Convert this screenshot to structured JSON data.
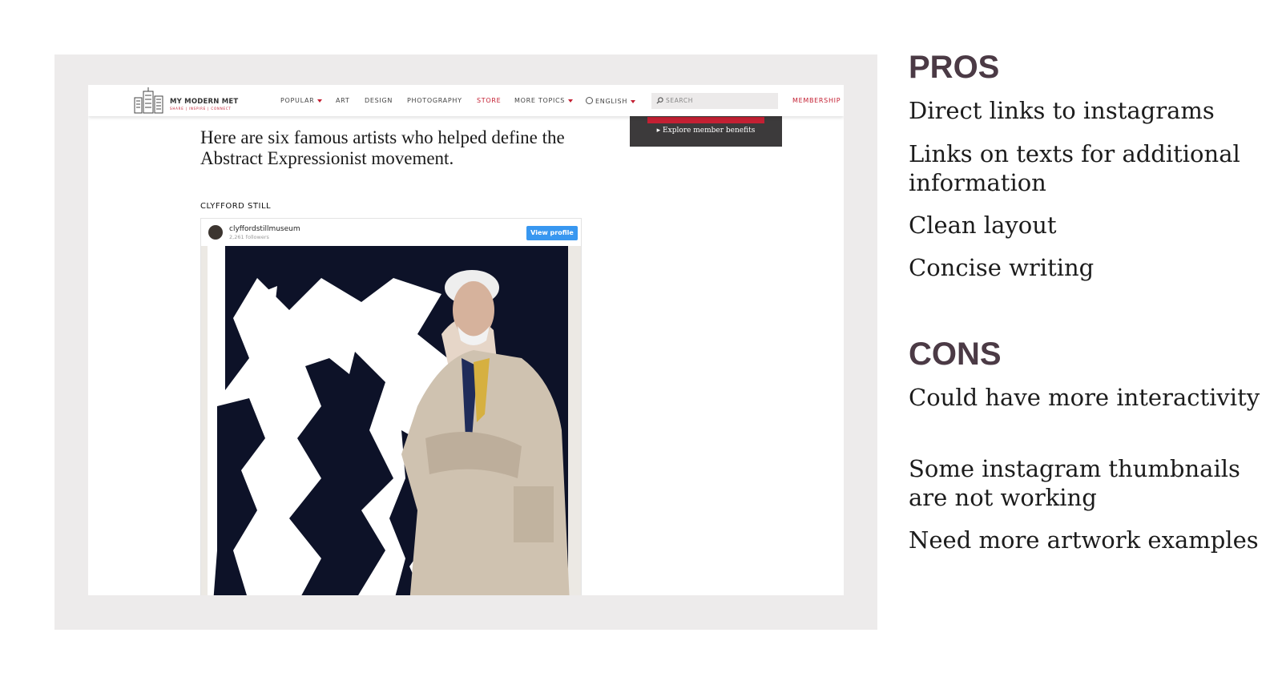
{
  "screenshot": {
    "nav": {
      "logo_title": "MY MODERN MET",
      "logo_subtitle": "SHARE | INSPIRE | CONNECT",
      "items": [
        "POPULAR",
        "ART",
        "DESIGN",
        "PHOTOGRAPHY",
        "STORE",
        "MORE TOPICS",
        "ENGLISH"
      ],
      "search_placeholder": "SEARCH",
      "membership": "MEMBERSHIP"
    },
    "promo": {
      "text": "Explore member benefits"
    },
    "lede": "Here are six famous artists who helped define the Abstract Expressionist movement.",
    "section_heading": "CLYFFORD STILL",
    "instagram": {
      "username": "clyffordstillmuseum",
      "followers": "2,261 followers",
      "button": "View profile"
    }
  },
  "pros": {
    "heading": "PROS",
    "items": [
      "Direct links to instagrams",
      "Links on texts for additional information",
      "Clean layout",
      "Concise writing"
    ]
  },
  "cons": {
    "heading": "CONS",
    "items": [
      "Could have more interactivity",
      "Some instagram thumbnails are not working",
      "Need more artwork examples"
    ]
  },
  "colors": {
    "frame_bg": "#edebeb",
    "accent_red": "#c42033",
    "heading_plum": "#4b3a45",
    "instagram_blue": "#3897f0"
  }
}
